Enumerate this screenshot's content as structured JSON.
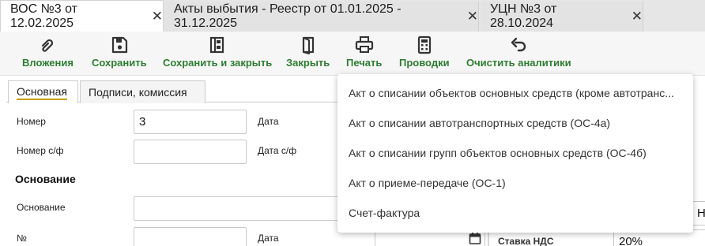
{
  "tabs": [
    {
      "label": "ВОС №3 от 12.02.2025",
      "active": true
    },
    {
      "label": "Акты выбытия - Реестр от 01.01.2025 - 31.12.2025",
      "active": false
    },
    {
      "label": "УЦН №3 от 28.10.2024",
      "active": false
    }
  ],
  "close_glyph": "✕",
  "toolbar": {
    "attachments": "Вложения",
    "save": "Сохранить",
    "save_close": "Сохранить и закрыть",
    "close": "Закрыть",
    "print": "Печать",
    "postings": "Проводки",
    "clear_analytics": "Очистить аналитики"
  },
  "inner_tabs": [
    "Основная",
    "Подписи, комиссия"
  ],
  "form": {
    "number_label": "Номер",
    "number_value": "3",
    "date_label": "Дата",
    "invoice_number_label": "Номер с/ф",
    "invoice_date_label": "Дата с/ф",
    "basis_section": "Основание",
    "basis_label": "Основание",
    "no_label": "№",
    "date2_label": "Дата",
    "vat_rate_label": "Ставка НДС",
    "vat_rate_value": "20%",
    "partial_right_value": "Н"
  },
  "print_menu": [
    "Акт о списании объектов основных средств (кроме автотранс...",
    "Акт о списании автотранспортных средств (ОС-4а)",
    "Акт о списании групп объектов основных средств (ОС-4б)",
    "Акт о приеме-передаче (ОС-1)",
    "Счет-фактура"
  ],
  "colors": {
    "toolbar_label": "#2e7d32",
    "tab_underline": "#c7a000"
  }
}
